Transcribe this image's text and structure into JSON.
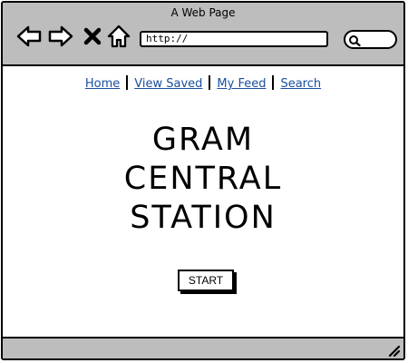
{
  "window": {
    "title": "A Web Page"
  },
  "toolbar": {
    "back_icon": "back-arrow-icon",
    "forward_icon": "forward-arrow-icon",
    "stop_icon": "close-x-icon",
    "home_icon": "home-icon",
    "search_icon": "search-icon"
  },
  "address_bar": {
    "value": "http://"
  },
  "nav": {
    "links": [
      {
        "label": "Home"
      },
      {
        "label": "View Saved"
      },
      {
        "label": "My Feed"
      },
      {
        "label": "Search"
      }
    ]
  },
  "hero": {
    "title_lines": [
      "GRAM",
      "CENTRAL",
      "STATION"
    ]
  },
  "start_button": {
    "label": "START"
  },
  "colors": {
    "chrome": "#bdbdbd",
    "link": "#1a4fa0",
    "border": "#000000",
    "background": "#ffffff"
  }
}
